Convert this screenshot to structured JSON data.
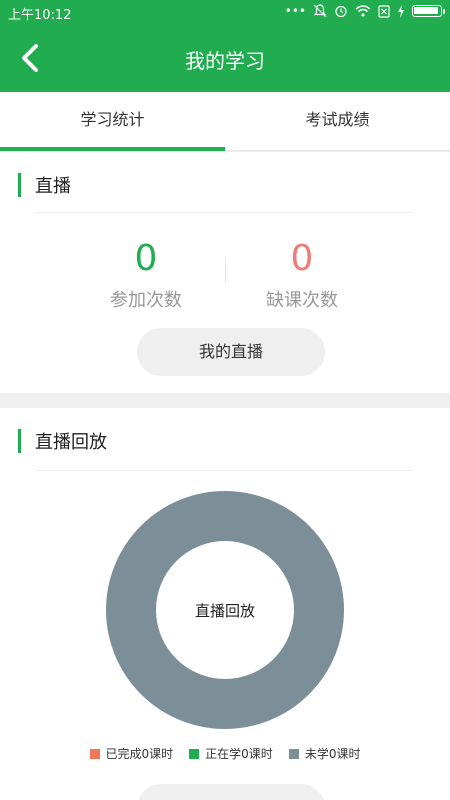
{
  "status_bar": {
    "time": "上午10:12",
    "icons": [
      "more-dots-icon",
      "bell-off-icon",
      "alarm-icon",
      "wifi-icon",
      "sim-off-icon",
      "charging-icon",
      "battery-icon"
    ],
    "battery_level": 1.0
  },
  "header": {
    "title": "我的学习",
    "back_icon": "back-arrow-icon"
  },
  "tabs": [
    {
      "label": "学习统计",
      "active": true
    },
    {
      "label": "考试成绩",
      "active": false
    }
  ],
  "live": {
    "title": "直播",
    "stats": [
      {
        "value": "0",
        "label": "参加次数",
        "color": "#21ad4f"
      },
      {
        "value": "0",
        "label": "缺课次数",
        "color": "#ef7c78"
      }
    ],
    "button_label": "我的直播"
  },
  "replay": {
    "title": "直播回放",
    "chart_center_label": "直播回放",
    "legend": [
      {
        "label": "已完成0课时",
        "color": "#f07757"
      },
      {
        "label": "正在学0课时",
        "color": "#21ad4f"
      },
      {
        "label": "未学0课时",
        "color": "#7c8f99"
      }
    ]
  },
  "chart_data": {
    "type": "pie",
    "title": "直播回放",
    "series": [
      {
        "name": "已完成0课时",
        "value": 0,
        "color": "#f07757"
      },
      {
        "name": "正在学0课时",
        "value": 0,
        "color": "#21ad4f"
      },
      {
        "name": "未学0课时",
        "value": 1,
        "color": "#7c8f99"
      }
    ],
    "legend_position": "bottom"
  },
  "colors": {
    "accent": "#21ad4f",
    "absence": "#ef7c78"
  }
}
